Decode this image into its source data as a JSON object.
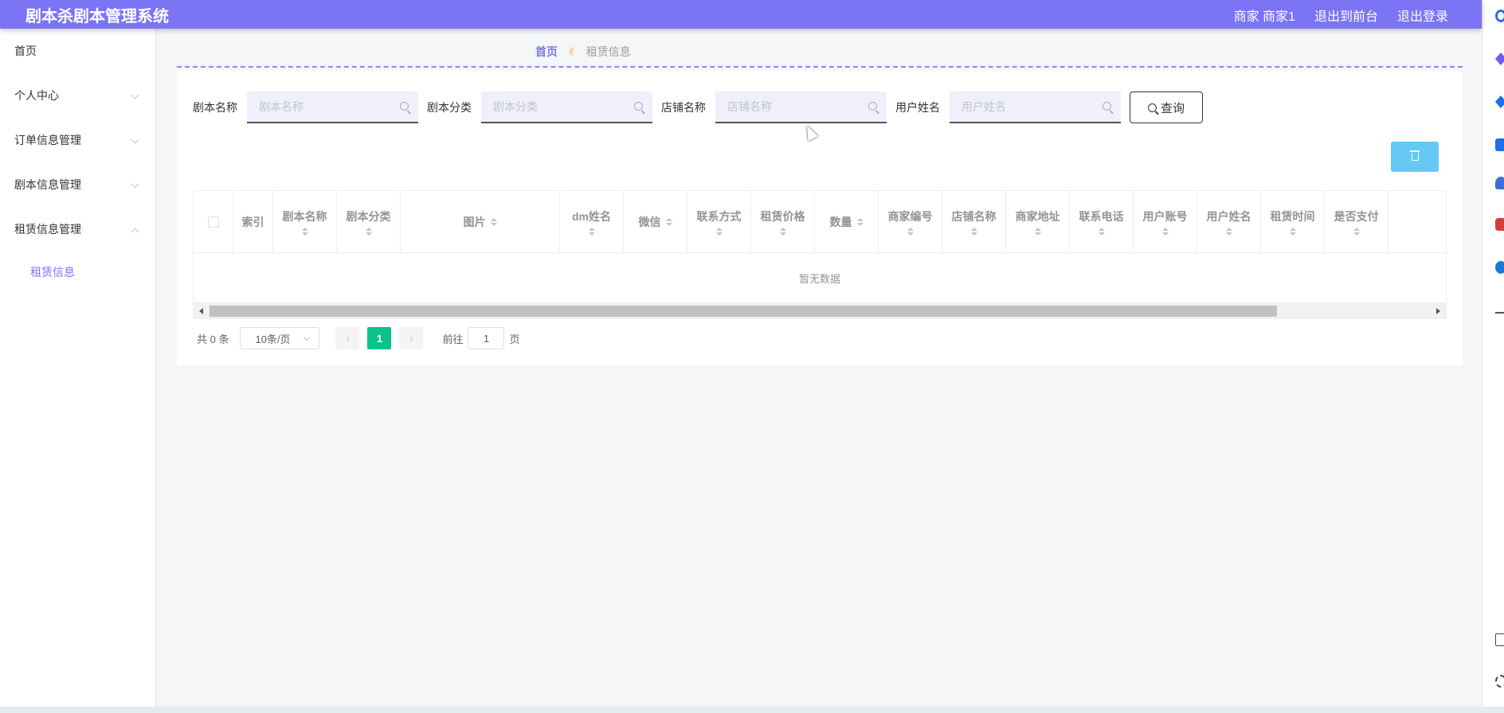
{
  "header": {
    "title": "剧本杀剧本管理系统",
    "user_label": "商家 商家1",
    "to_front": "退出到前台",
    "logout": "退出登录"
  },
  "sidebar": {
    "items": [
      {
        "label": "首页"
      },
      {
        "label": "个人中心"
      },
      {
        "label": "订单信息管理"
      },
      {
        "label": "剧本信息管理"
      },
      {
        "label": "租赁信息管理"
      }
    ],
    "sub_item": "租赁信息"
  },
  "breadcrumb": {
    "home": "首页",
    "separator": "✌",
    "current": "租赁信息"
  },
  "search": {
    "fields": [
      {
        "label": "剧本名称",
        "placeholder": "剧本名称"
      },
      {
        "label": "剧本分类",
        "placeholder": "剧本分类"
      },
      {
        "label": "店铺名称",
        "placeholder": "店铺名称"
      },
      {
        "label": "用户姓名",
        "placeholder": "用户姓名"
      }
    ],
    "button": "查询"
  },
  "table": {
    "columns": [
      "索引",
      "剧本名称",
      "剧本分类",
      "图片",
      "dm姓名",
      "微信",
      "联系方式",
      "租赁价格",
      "数量",
      "商家编号",
      "店铺名称",
      "商家地址",
      "联系电话",
      "用户账号",
      "用户姓名",
      "租赁时间",
      "是否支付"
    ],
    "empty_text": "暂无数据"
  },
  "pagination": {
    "total": "共 0 条",
    "page_size": "10条/页",
    "prev": "‹",
    "current_page": "1",
    "next": "›",
    "goto_label": "前往",
    "goto_value": "1",
    "page_suffix": "页"
  },
  "colors": {
    "header_bg": "#7b74f5",
    "accent": "#7b74f5",
    "page_active": "#0bc28a",
    "delete_btn": "#66c8f5"
  }
}
